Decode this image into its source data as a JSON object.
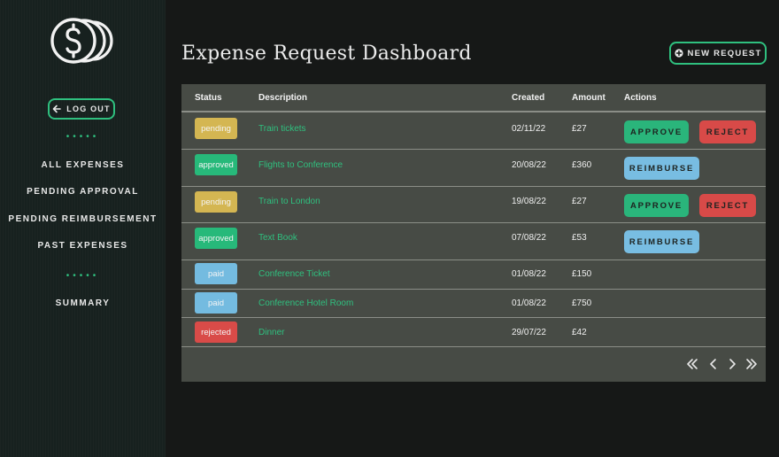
{
  "colors": {
    "accent": "#2fc07f",
    "pending": "#d4b652",
    "approved": "#27b97a",
    "paid": "#74bbe0",
    "rejected": "#d94b48",
    "approve_btn": "#2ab57b",
    "reject_btn": "#d84a48",
    "reimburse_btn": "#78bde2"
  },
  "sidebar": {
    "logo_icon": "dollar-coins-icon",
    "logout_label": "LOG OUT",
    "dots": "•••••",
    "nav": [
      {
        "label": "ALL EXPENSES"
      },
      {
        "label": "PENDING APPROVAL"
      },
      {
        "label": "PENDING REIMBURSEMENT"
      },
      {
        "label": "PAST EXPENSES"
      }
    ],
    "summary_label": "SUMMARY"
  },
  "header": {
    "title": "Expense Request Dashboard",
    "new_request_label": "NEW REQUEST"
  },
  "table": {
    "columns": [
      "Status",
      "Description",
      "Created",
      "Amount",
      "Actions"
    ],
    "rows": [
      {
        "status": "pending",
        "description": "Train tickets",
        "created": "02/11/22",
        "amount": "£27",
        "actions": [
          "APPROVE",
          "REJECT"
        ]
      },
      {
        "status": "approved",
        "description": "Flights to Conference",
        "created": "20/08/22",
        "amount": "£360",
        "actions": [
          "REIMBURSE"
        ]
      },
      {
        "status": "pending",
        "description": "Train to London",
        "created": "19/08/22",
        "amount": "£27",
        "actions": [
          "APPROVE",
          "REJECT"
        ]
      },
      {
        "status": "approved",
        "description": "Text Book",
        "created": "07/08/22",
        "amount": "£53",
        "actions": [
          "REIMBURSE"
        ]
      },
      {
        "status": "paid",
        "description": "Conference Ticket",
        "created": "01/08/22",
        "amount": "£150",
        "actions": []
      },
      {
        "status": "paid",
        "description": "Conference Hotel Room",
        "created": "01/08/22",
        "amount": "£750",
        "actions": []
      },
      {
        "status": "rejected",
        "description": "Dinner",
        "created": "29/07/22",
        "amount": "£42",
        "actions": []
      }
    ]
  },
  "pagination": {
    "icons": [
      "first-page-icon",
      "previous-page-icon",
      "next-page-icon",
      "last-page-icon"
    ]
  }
}
